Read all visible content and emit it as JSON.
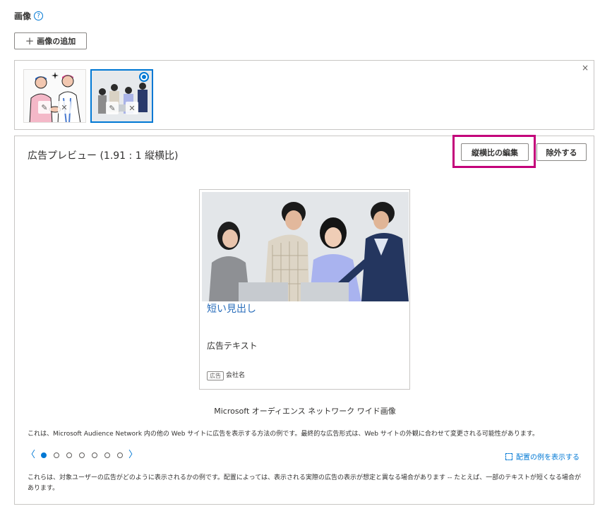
{
  "section": {
    "title": "画像",
    "help_glyph": "?"
  },
  "add_button": {
    "icon": "plus-icon",
    "label": "画像の追加",
    "plus_glyph": "+"
  },
  "thumbnails": {
    "close_glyph": "×",
    "edit_glyph": "✎",
    "remove_glyph": "✕"
  },
  "preview": {
    "title": "広告プレビュー (1.91 : 1 縦横比)",
    "aspect_button": "縦横比の編集",
    "exclude_button": "除外する",
    "highlight_color": "#c3007a"
  },
  "ad": {
    "headline": "短い見出し",
    "text": "広告テキスト",
    "badge": "広告",
    "company": "会社名"
  },
  "caption": "Microsoft オーディエンス ネットワーク ワイド画像",
  "description": "これは、Microsoft Audience Network 内の他の Web サイトに広告を表示する方法の例です。最終的な広告形式は、Web サイトの外観に合わせて変更される可能性があります。",
  "pager": {
    "prev_glyph": "〈",
    "next_glyph": "〉",
    "total": 8,
    "active": 1
  },
  "example_link": "配置の例を表示する",
  "footer_note": "これらは、対象ユーザーの広告がどのように表示されるかの例です。配置によっては、表示される実際の広告の表示が想定と異なる場合があります -- たとえば、一部のテキストが短くなる場合があります。",
  "colors": {
    "accent": "#0078d4",
    "link": "#2a6ebb",
    "border": "#c8c6c4"
  }
}
